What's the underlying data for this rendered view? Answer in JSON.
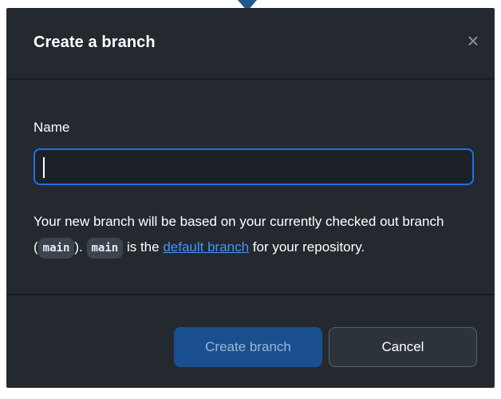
{
  "dialog": {
    "title": "Create a branch",
    "close_symbol": "×"
  },
  "form": {
    "name_label": "Name",
    "name_value": "",
    "desc_part1": "Your new branch will be based on your currently checked out branch (",
    "current_branch": "main",
    "desc_part2": "). ",
    "default_branch": "main",
    "desc_part3": " is the ",
    "default_branch_link": "default branch",
    "desc_part4": " for your repository."
  },
  "footer": {
    "create_label": "Create branch",
    "cancel_label": "Cancel"
  },
  "colors": {
    "dialog_bg": "#24292f",
    "accent": "#1f6feb",
    "link": "#4493f8",
    "create_button_bg": "#1a4f8f"
  },
  "icons": {
    "close": "close-icon",
    "pointer": "caret-down-icon"
  }
}
